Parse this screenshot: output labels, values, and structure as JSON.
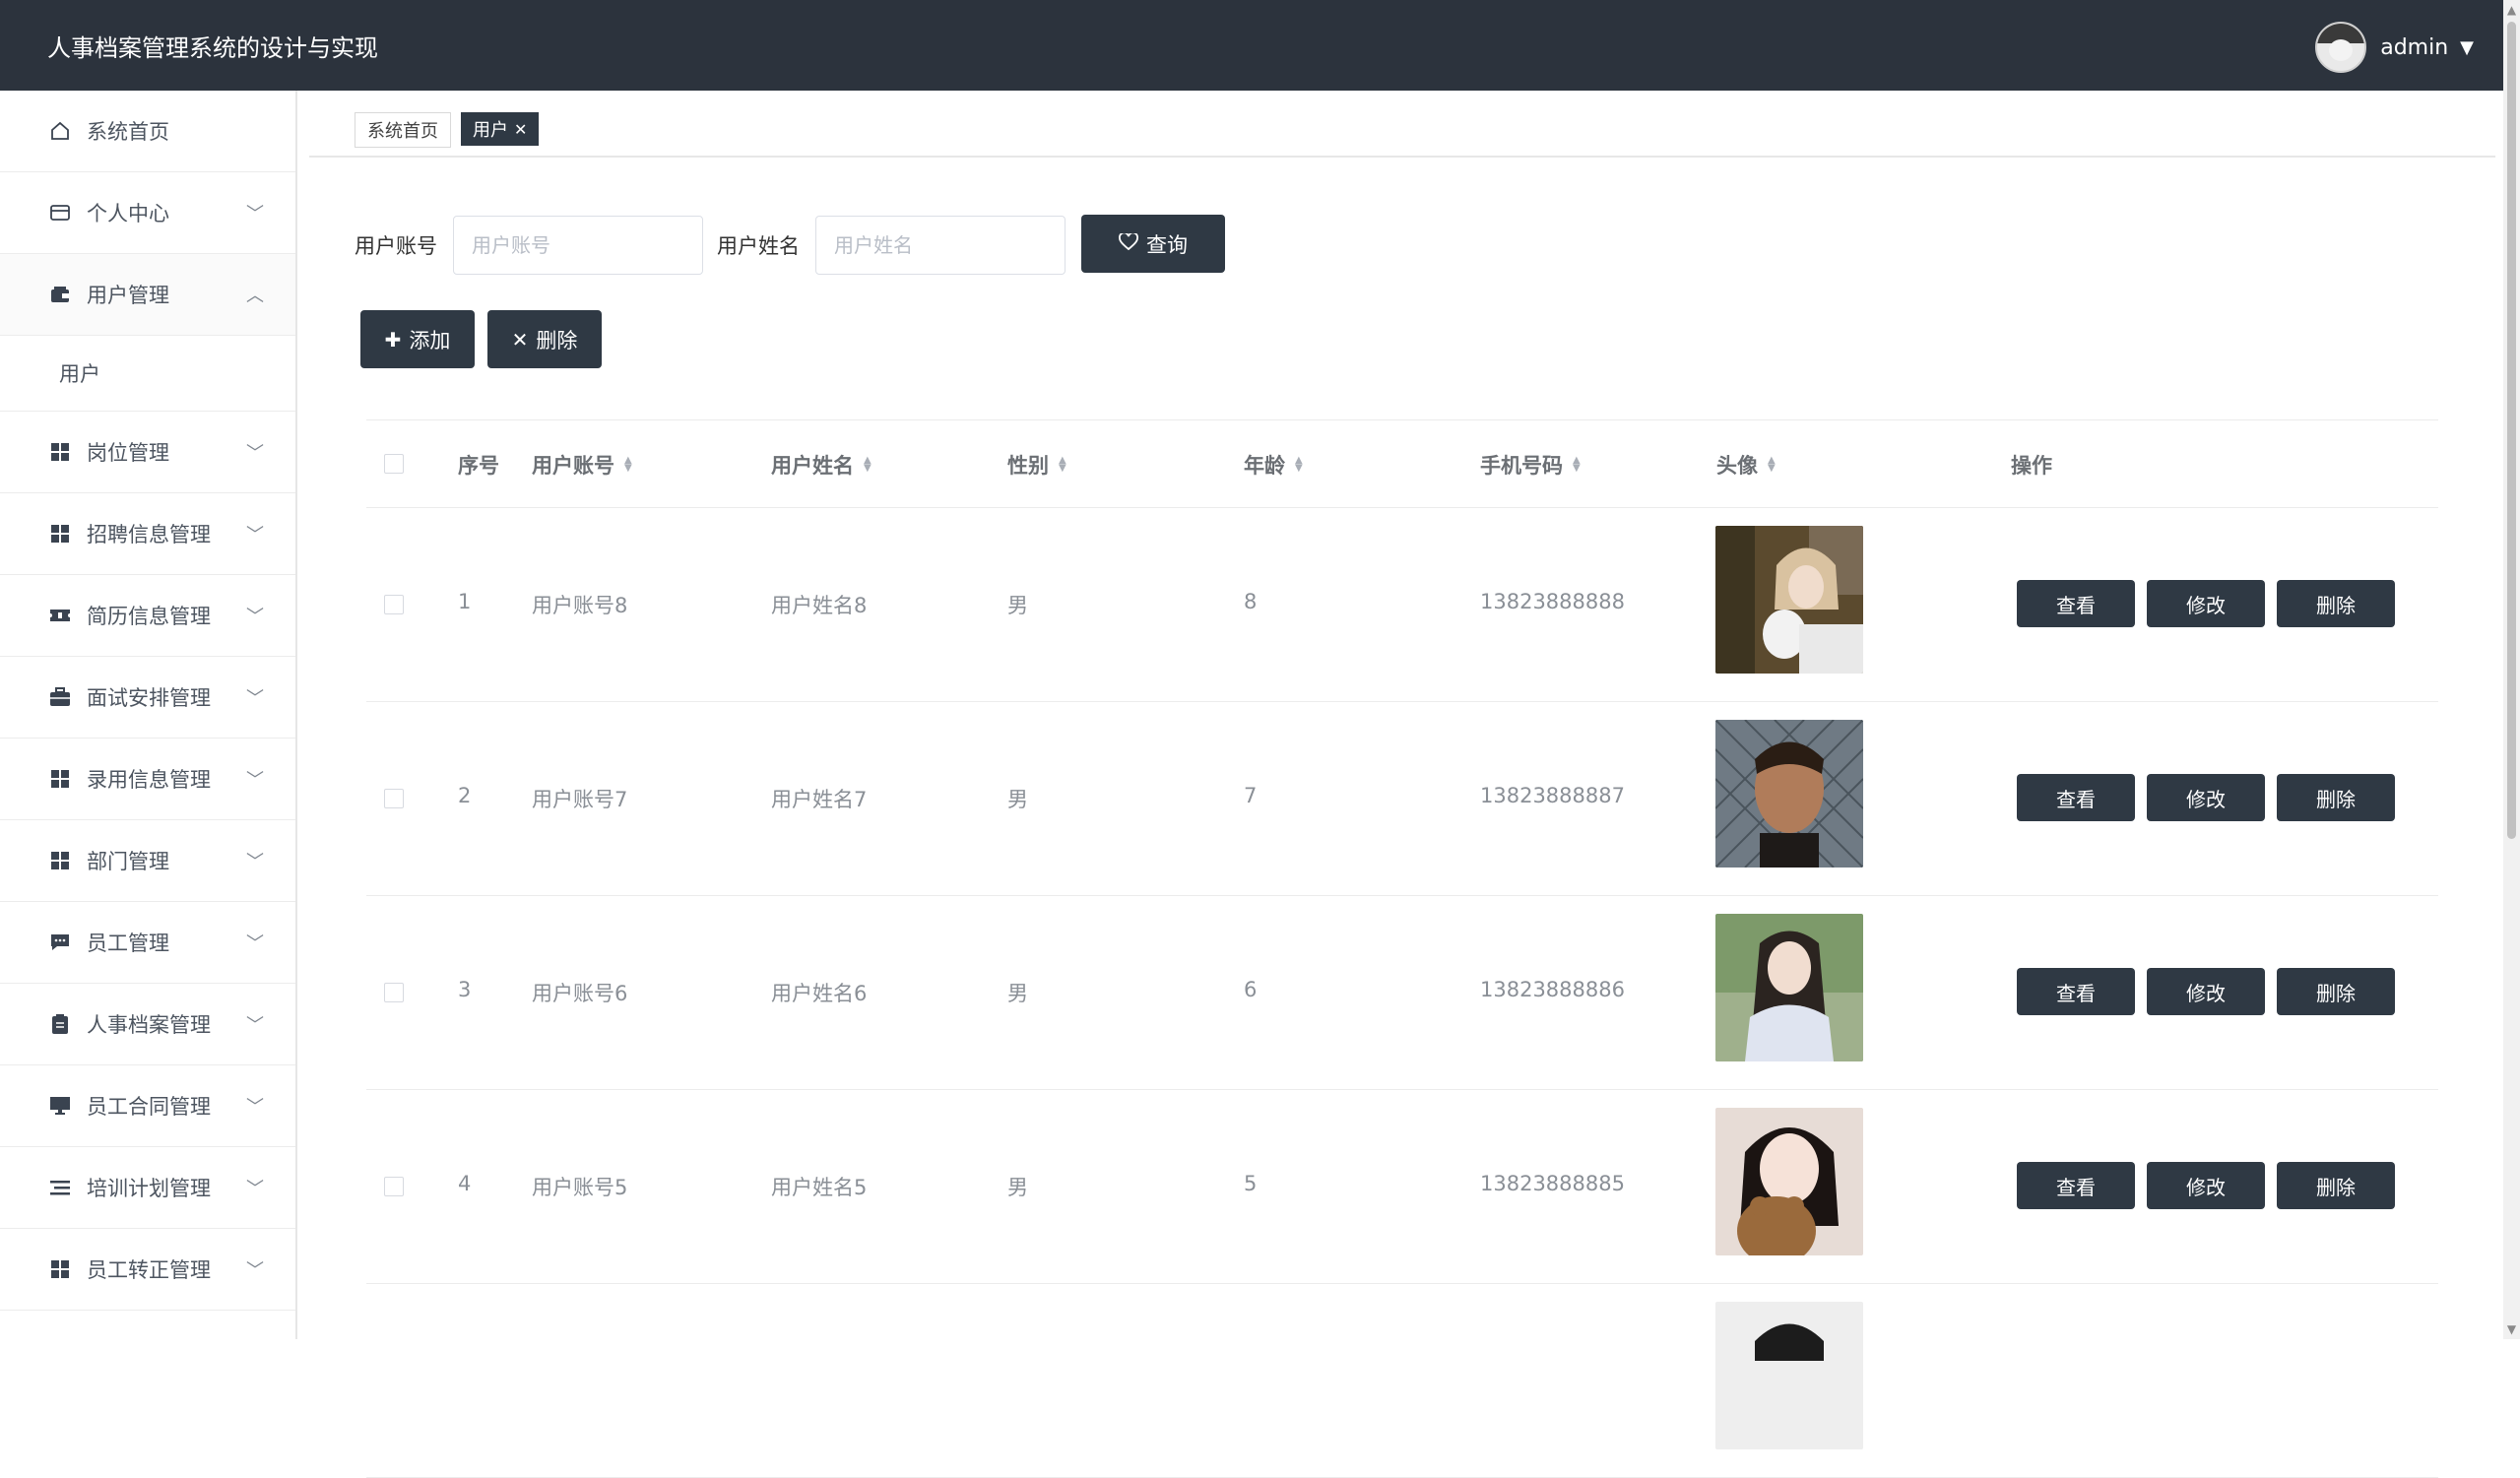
{
  "app": {
    "title": "人事档案管理系统的设计与实现",
    "user": "admin"
  },
  "sidebar": {
    "items": [
      {
        "label": "系统首页",
        "icon": "home-icon",
        "chevron": false
      },
      {
        "label": "个人中心",
        "icon": "id-card-icon",
        "chevron": true
      },
      {
        "label": "用户管理",
        "icon": "wallet-icon",
        "chevron": true,
        "expanded": true
      },
      {
        "label": "岗位管理",
        "icon": "grid-icon",
        "chevron": true
      },
      {
        "label": "招聘信息管理",
        "icon": "grid-icon",
        "chevron": true
      },
      {
        "label": "简历信息管理",
        "icon": "ticket-icon",
        "chevron": true
      },
      {
        "label": "面试安排管理",
        "icon": "briefcase-icon",
        "chevron": true
      },
      {
        "label": "录用信息管理",
        "icon": "grid-icon",
        "chevron": true
      },
      {
        "label": "部门管理",
        "icon": "grid-icon",
        "chevron": true
      },
      {
        "label": "员工管理",
        "icon": "chat-icon",
        "chevron": true
      },
      {
        "label": "人事档案管理",
        "icon": "clipboard-icon",
        "chevron": true
      },
      {
        "label": "员工合同管理",
        "icon": "monitor-icon",
        "chevron": true
      },
      {
        "label": "培训计划管理",
        "icon": "list-icon",
        "chevron": true
      },
      {
        "label": "员工转正管理",
        "icon": "grid-icon",
        "chevron": true
      }
    ],
    "subitem": "用户"
  },
  "tabs": [
    {
      "label": "系统首页"
    },
    {
      "label": "用户",
      "close": "✕"
    }
  ],
  "search": {
    "account_label": "用户账号",
    "account_placeholder": "用户账号",
    "name_label": "用户姓名",
    "name_placeholder": "用户姓名",
    "query_label": "查询"
  },
  "actions": {
    "add_label": "添加",
    "delete_label": "删除"
  },
  "table": {
    "columns": [
      "序号",
      "用户账号",
      "用户姓名",
      "性别",
      "年龄",
      "手机号码",
      "头像",
      "操作"
    ],
    "rows": [
      {
        "index": "1",
        "account": "用户账号8",
        "name": "用户姓名8",
        "gender": "男",
        "age": "8",
        "phone": "13823888888"
      },
      {
        "index": "2",
        "account": "用户账号7",
        "name": "用户姓名7",
        "gender": "男",
        "age": "7",
        "phone": "13823888887"
      },
      {
        "index": "3",
        "account": "用户账号6",
        "name": "用户姓名6",
        "gender": "男",
        "age": "6",
        "phone": "13823888886"
      },
      {
        "index": "4",
        "account": "用户账号5",
        "name": "用户姓名5",
        "gender": "男",
        "age": "5",
        "phone": "13823888885"
      }
    ],
    "row_actions": {
      "view": "查看",
      "edit": "修改",
      "delete": "删除"
    }
  },
  "colors": {
    "header_bg": "#2c333d",
    "button_bg": "#2f3944"
  }
}
